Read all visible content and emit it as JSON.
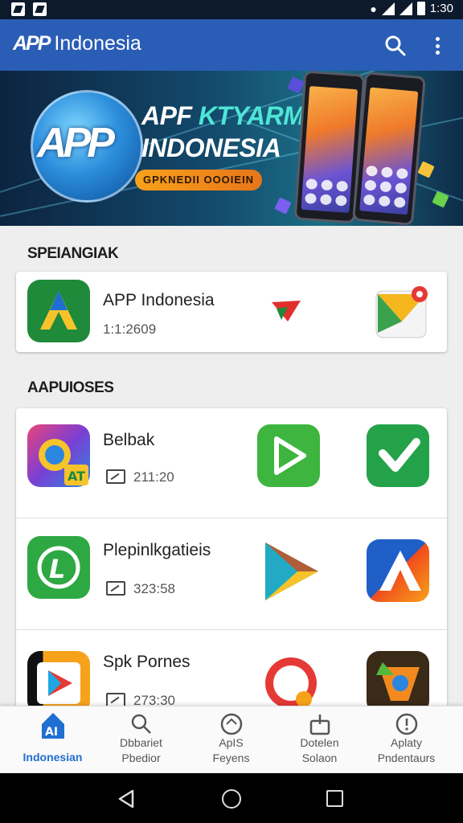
{
  "status_bar": {
    "time": "1:30"
  },
  "app_bar": {
    "title": "Indonesia",
    "logo_text": "APP"
  },
  "banner": {
    "logo_text": "APP",
    "title_line1_a": "APF",
    "title_line1_b": "KTYARM",
    "title_line2": "INDONESIA",
    "cta_label": "GPKNEDII OOOIEIN"
  },
  "featured": {
    "heading": "SPEIANGIAK",
    "item": {
      "name": "APP Indonesia",
      "meta": "1:1:2609"
    }
  },
  "apps_section": {
    "heading": "AAPUIOSES",
    "items": [
      {
        "name": "Belbak",
        "meta": "211:20"
      },
      {
        "name": "Plepinlkgatieis",
        "meta": "323:58"
      },
      {
        "name": "Spk Pornes",
        "meta": "273:30"
      }
    ]
  },
  "bottom_nav": [
    {
      "line1": "Indonesian",
      "line2": "",
      "active": true
    },
    {
      "line1": "Dbbariet",
      "line2": "Pbedior",
      "active": false
    },
    {
      "line1": "ApIS",
      "line2": "Feyens",
      "active": false
    },
    {
      "line1": "Dotelen",
      "line2": "Solaon",
      "active": false
    },
    {
      "line1": "Aplaty",
      "line2": "Pndentaurs",
      "active": false
    }
  ],
  "colors": {
    "app_bar": "#2a5db5",
    "active_nav": "#1f6fd1",
    "status_bar": "#0d1a2c"
  }
}
